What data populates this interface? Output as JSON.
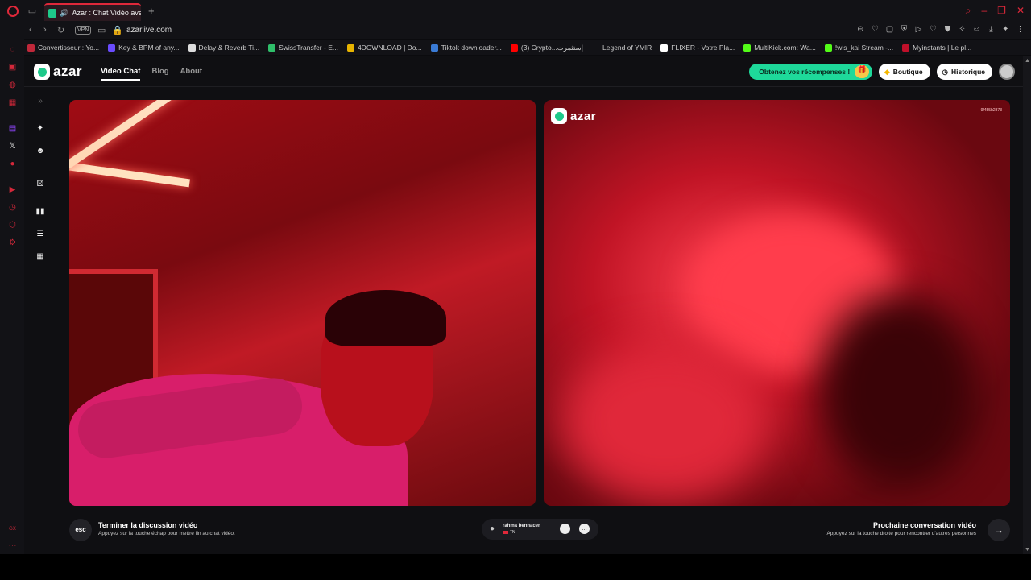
{
  "browser": {
    "tab_title": "Azar : Chat Vidéo avec",
    "tab_sound_icon": "speaker-icon",
    "new_tab": "+",
    "vpn_label": "VPN",
    "url": "azarlive.com",
    "accent_color": "#e0283a"
  },
  "bookmarks": [
    {
      "label": "Convertisseur : Yo...",
      "color": "#c0283a"
    },
    {
      "label": "Key & BPM of any...",
      "color": "#6a4cff"
    },
    {
      "label": "Delay & Reverb Ti...",
      "color": "#dddddd"
    },
    {
      "label": "SwissTransfer - E...",
      "color": "#2fbf6a"
    },
    {
      "label": "4DOWNLOAD | Do...",
      "color": "#e8b400"
    },
    {
      "label": "Tiktok downloader...",
      "color": "#3a7bd5"
    },
    {
      "label": "(3) Crypto...إستثمرت",
      "color": "#ff0000"
    },
    {
      "label": "Legend of YMIR",
      "color": "#121216"
    },
    {
      "label": "FLIXER - Votre Pla...",
      "color": "#ffffff"
    },
    {
      "label": "MultiKick.com: Wa...",
      "color": "#53fc18"
    },
    {
      "label": "!wis_kai Stream -...",
      "color": "#53fc18"
    },
    {
      "label": "Myinstants | Le pl...",
      "color": "#c0102a"
    }
  ],
  "site": {
    "logo_text": "azar",
    "brand_color": "#1ec98a",
    "nav": [
      {
        "label": "Video Chat",
        "active": true
      },
      {
        "label": "Blog",
        "active": false
      },
      {
        "label": "About",
        "active": false
      }
    ],
    "reward_label": "Obtenez vos récompenses !",
    "shop_label": "Boutique",
    "history_label": "Historique"
  },
  "video": {
    "remote_logo": "azar",
    "remote_id": "9f455b2373"
  },
  "bottom": {
    "esc_key": "esc",
    "end_title": "Terminer la discussion vidéo",
    "end_sub": "Appuyez sur la touche échap pour mettre fin au chat vidéo.",
    "partner_name": "rahma bennacer",
    "partner_country": "TN",
    "next_title": "Prochaine conversation vidéo",
    "next_sub": "Appuyez sur la touche droite pour rencontrer d'autres personnes"
  }
}
